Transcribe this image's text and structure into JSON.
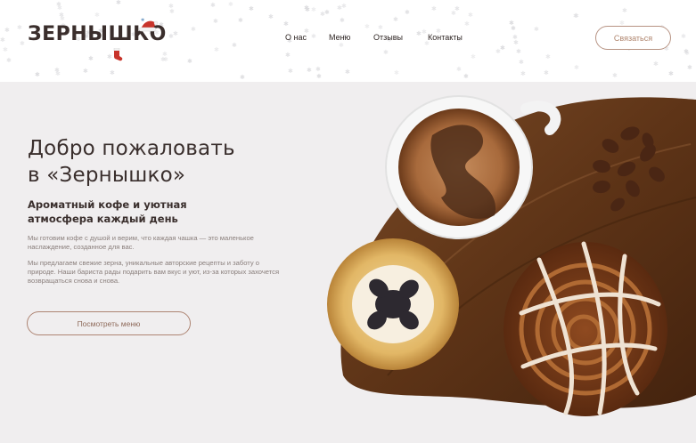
{
  "brand": {
    "name": "ЗЕРНЫШКО"
  },
  "nav": {
    "items": [
      {
        "label": "О нас"
      },
      {
        "label": "Меню"
      },
      {
        "label": "Отзывы"
      },
      {
        "label": "Контакты"
      }
    ],
    "contact_label": "Связаться"
  },
  "hero": {
    "title_line1": "Добро пожаловать",
    "title_line2": "в «Зернышко»",
    "subtitle": "Ароматный кофе и уютная атмосфера каждый день",
    "paragraph1": "Мы готовим кофе с душой и верим, что каждая чашка — это маленькое наслаждение, созданное для вас.",
    "paragraph2": "Мы предлагаем свежие зерна, уникальные авторские рецепты и заботу о природе. Наши бариста рады подарить вам вкус и уют, из-за которых захочется возвращаться снова и снова.",
    "cta_label": "Посмотреть меню"
  },
  "icons": {
    "logo_hat": "santa-hat-icon",
    "logo_sock": "christmas-stocking-icon"
  },
  "colors": {
    "header_bg": "#ffffff",
    "hero_bg": "#f0eeef",
    "text_dark": "#3a2f2d",
    "accent_brown": "#ad8472",
    "muted_text": "#8a7f7c"
  }
}
